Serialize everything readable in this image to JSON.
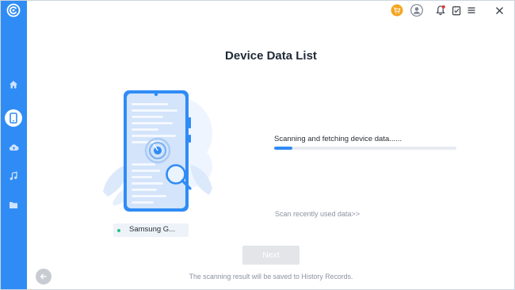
{
  "app": {
    "accent_color": "#2f8cf5",
    "logo_icon": "app-logo-icon"
  },
  "sidebar": {
    "items": [
      {
        "id": "home",
        "icon": "home-icon"
      },
      {
        "id": "device",
        "icon": "phone-icon",
        "active": true
      },
      {
        "id": "backup",
        "icon": "cloud-icon"
      },
      {
        "id": "music",
        "icon": "music-note-icon"
      },
      {
        "id": "files",
        "icon": "folder-icon"
      }
    ]
  },
  "topbar": {
    "icons": [
      "cart-icon",
      "user-avatar-icon",
      "notification-bell-icon",
      "feedback-icon",
      "menu-icon",
      "close-icon"
    ]
  },
  "main": {
    "title": "Device Data List",
    "device_name": "Samsung G...",
    "status_text": "Scanning and fetching device data......",
    "progress": 0.1,
    "scan_recent_link": "Scan recently used data>>",
    "next_label": "Next",
    "footer_note": "The scanning result will be saved to History Records."
  }
}
